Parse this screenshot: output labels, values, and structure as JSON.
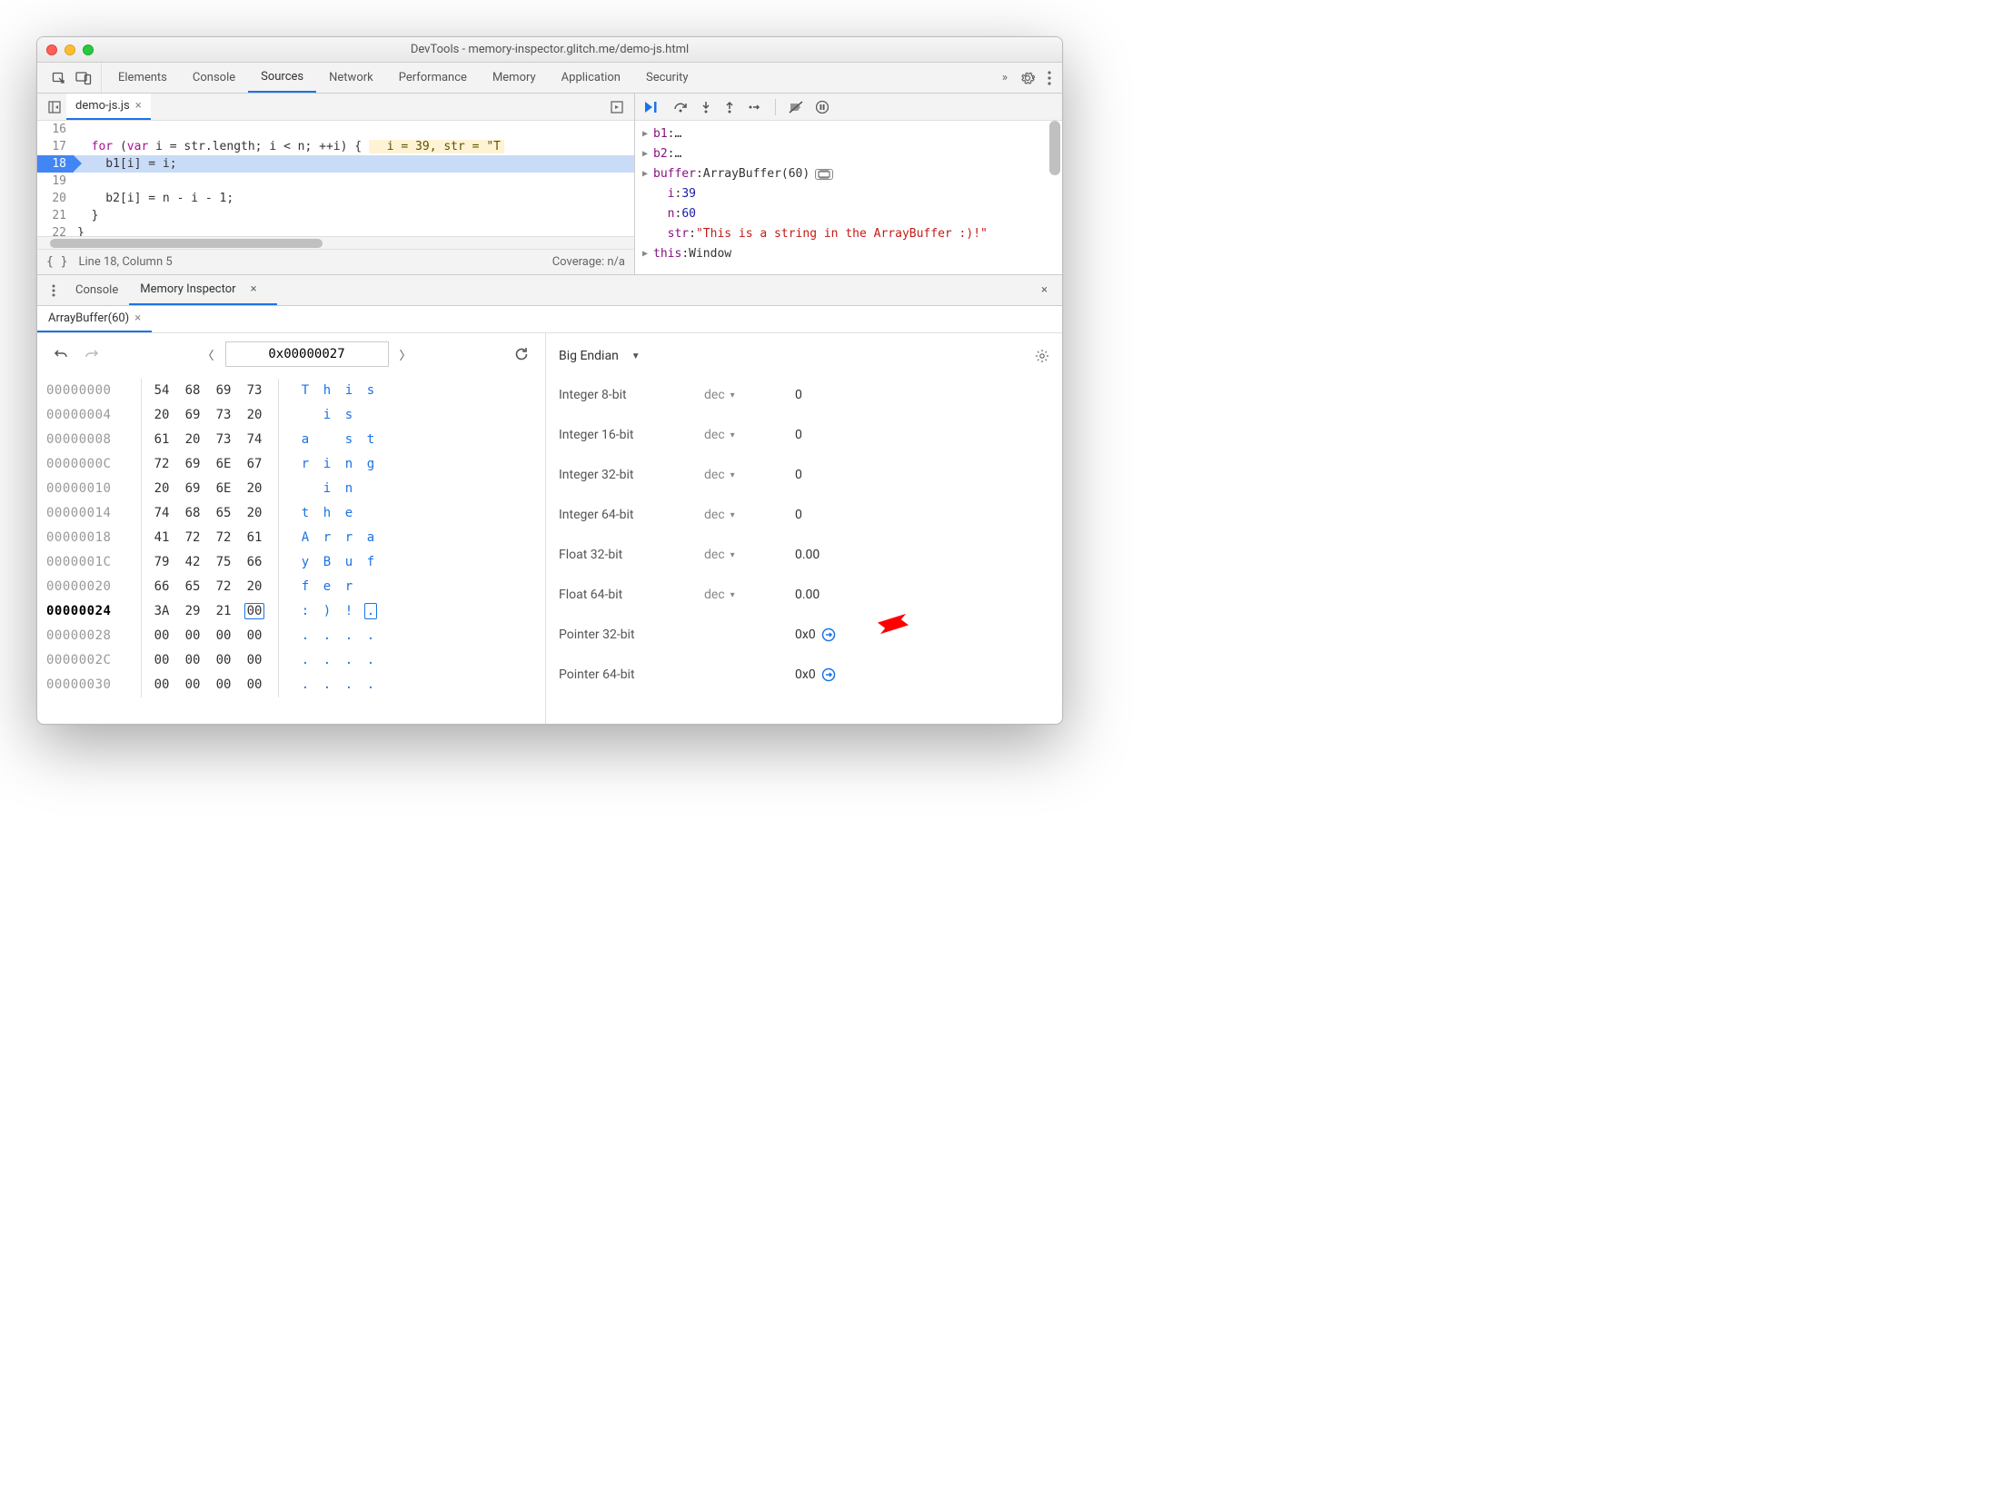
{
  "window": {
    "title": "DevTools - memory-inspector.glitch.me/demo-js.html"
  },
  "mainTabs": {
    "items": [
      "Elements",
      "Console",
      "Sources",
      "Network",
      "Performance",
      "Memory",
      "Application",
      "Security"
    ],
    "activeIndex": 2,
    "overflow": "»"
  },
  "source": {
    "fileTab": "demo-js.js",
    "gutter": [
      "16",
      "17",
      "18",
      "19",
      "20",
      "21",
      "22"
    ],
    "highlightLineIndex": 2,
    "lines": {
      "l16": "",
      "l17_pre": "  for (var i = str.length; i < n; ++i) {",
      "l17_inline": "  i = 39, str = \"T",
      "l18": "    b1[i] = i;",
      "l19": "    b2[i] = n - i - 1;",
      "l20": "  }",
      "l21": "}",
      "l22": ""
    },
    "status": {
      "braces": "{ }",
      "cursor": "Line 18, Column 5",
      "coverage": "Coverage: n/a"
    }
  },
  "scope": {
    "b1": {
      "label": "b1",
      "value": "…"
    },
    "b2": {
      "label": "b2",
      "value": "…"
    },
    "buffer": {
      "label": "buffer",
      "value": "ArrayBuffer(60)"
    },
    "i": {
      "label": "i",
      "value": "39"
    },
    "n": {
      "label": "n",
      "value": "60"
    },
    "str": {
      "label": "str",
      "value": "\"This is a string in the ArrayBuffer :)!\""
    },
    "this": {
      "label": "this",
      "value": "Window"
    }
  },
  "drawer": {
    "tabs": {
      "console": "Console",
      "memory": "Memory Inspector"
    },
    "memTab": "ArrayBuffer(60)"
  },
  "mem": {
    "address": "0x00000027",
    "rows": [
      {
        "addr": "00000000",
        "bytes": [
          "54",
          "68",
          "69",
          "73"
        ],
        "ascii": [
          "T",
          "h",
          "i",
          "s"
        ]
      },
      {
        "addr": "00000004",
        "bytes": [
          "20",
          "69",
          "73",
          "20"
        ],
        "ascii": [
          " ",
          "i",
          "s",
          " "
        ]
      },
      {
        "addr": "00000008",
        "bytes": [
          "61",
          "20",
          "73",
          "74"
        ],
        "ascii": [
          "a",
          " ",
          "s",
          "t"
        ]
      },
      {
        "addr": "0000000C",
        "bytes": [
          "72",
          "69",
          "6E",
          "67"
        ],
        "ascii": [
          "r",
          "i",
          "n",
          "g"
        ]
      },
      {
        "addr": "00000010",
        "bytes": [
          "20",
          "69",
          "6E",
          "20"
        ],
        "ascii": [
          " ",
          "i",
          "n",
          " "
        ]
      },
      {
        "addr": "00000014",
        "bytes": [
          "74",
          "68",
          "65",
          "20"
        ],
        "ascii": [
          "t",
          "h",
          "e",
          " "
        ]
      },
      {
        "addr": "00000018",
        "bytes": [
          "41",
          "72",
          "72",
          "61"
        ],
        "ascii": [
          "A",
          "r",
          "r",
          "a"
        ]
      },
      {
        "addr": "0000001C",
        "bytes": [
          "79",
          "42",
          "75",
          "66"
        ],
        "ascii": [
          "y",
          "B",
          "u",
          "f"
        ]
      },
      {
        "addr": "00000020",
        "bytes": [
          "66",
          "65",
          "72",
          "20"
        ],
        "ascii": [
          "f",
          "e",
          "r",
          " "
        ]
      },
      {
        "addr": "00000024",
        "bytes": [
          "3A",
          "29",
          "21",
          "00"
        ],
        "ascii": [
          ":",
          ")",
          "!",
          "."
        ],
        "current": true,
        "selByte": 3,
        "selAscii": 3
      },
      {
        "addr": "00000028",
        "bytes": [
          "00",
          "00",
          "00",
          "00"
        ],
        "ascii": [
          ".",
          ".",
          ".",
          "."
        ]
      },
      {
        "addr": "0000002C",
        "bytes": [
          "00",
          "00",
          "00",
          "00"
        ],
        "ascii": [
          ".",
          ".",
          ".",
          "."
        ]
      },
      {
        "addr": "00000030",
        "bytes": [
          "00",
          "00",
          "00",
          "00"
        ],
        "ascii": [
          ".",
          ".",
          ".",
          "."
        ]
      }
    ]
  },
  "values": {
    "endian": "Big Endian",
    "fmt": "dec",
    "rows": [
      {
        "name": "Integer 8-bit",
        "fmt": true,
        "value": "0"
      },
      {
        "name": "Integer 16-bit",
        "fmt": true,
        "value": "0"
      },
      {
        "name": "Integer 32-bit",
        "fmt": true,
        "value": "0"
      },
      {
        "name": "Integer 64-bit",
        "fmt": true,
        "value": "0"
      },
      {
        "name": "Float 32-bit",
        "fmt": true,
        "value": "0.00"
      },
      {
        "name": "Float 64-bit",
        "fmt": true,
        "value": "0.00"
      },
      {
        "name": "Pointer 32-bit",
        "fmt": false,
        "value": "0x0",
        "goto": true
      },
      {
        "name": "Pointer 64-bit",
        "fmt": false,
        "value": "0x0",
        "goto": true
      }
    ]
  }
}
